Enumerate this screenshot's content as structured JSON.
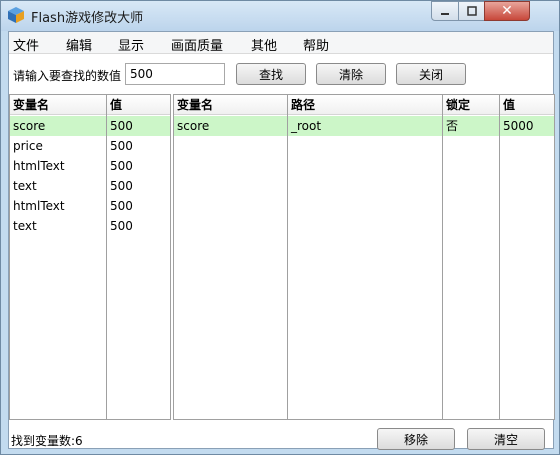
{
  "window": {
    "title": "Flash游戏修改大师"
  },
  "menu": [
    "文件",
    "编辑",
    "显示",
    "画面质量",
    "其他",
    "帮助"
  ],
  "search": {
    "label": "请输入要查找的数值",
    "value": "500",
    "find_label": "查找",
    "clear_label": "清除",
    "close_label": "关闭"
  },
  "left_table": {
    "headers": [
      "变量名",
      "值"
    ],
    "rows": [
      [
        "score",
        "500"
      ],
      [
        "price",
        "500"
      ],
      [
        "htmlText",
        "500"
      ],
      [
        "text",
        "500"
      ],
      [
        "htmlText",
        "500"
      ],
      [
        "text",
        "500"
      ]
    ]
  },
  "right_table": {
    "headers": [
      "变量名",
      "路径",
      "锁定",
      "值"
    ],
    "rows": [
      [
        "score",
        "_root",
        "否",
        "5000"
      ]
    ]
  },
  "status": {
    "found_text": "找到变量数:6",
    "remove_label": "移除",
    "clear_all_label": "清空"
  },
  "colors": {
    "selection": "#ccf6c8",
    "frame": "#c3dbef"
  }
}
